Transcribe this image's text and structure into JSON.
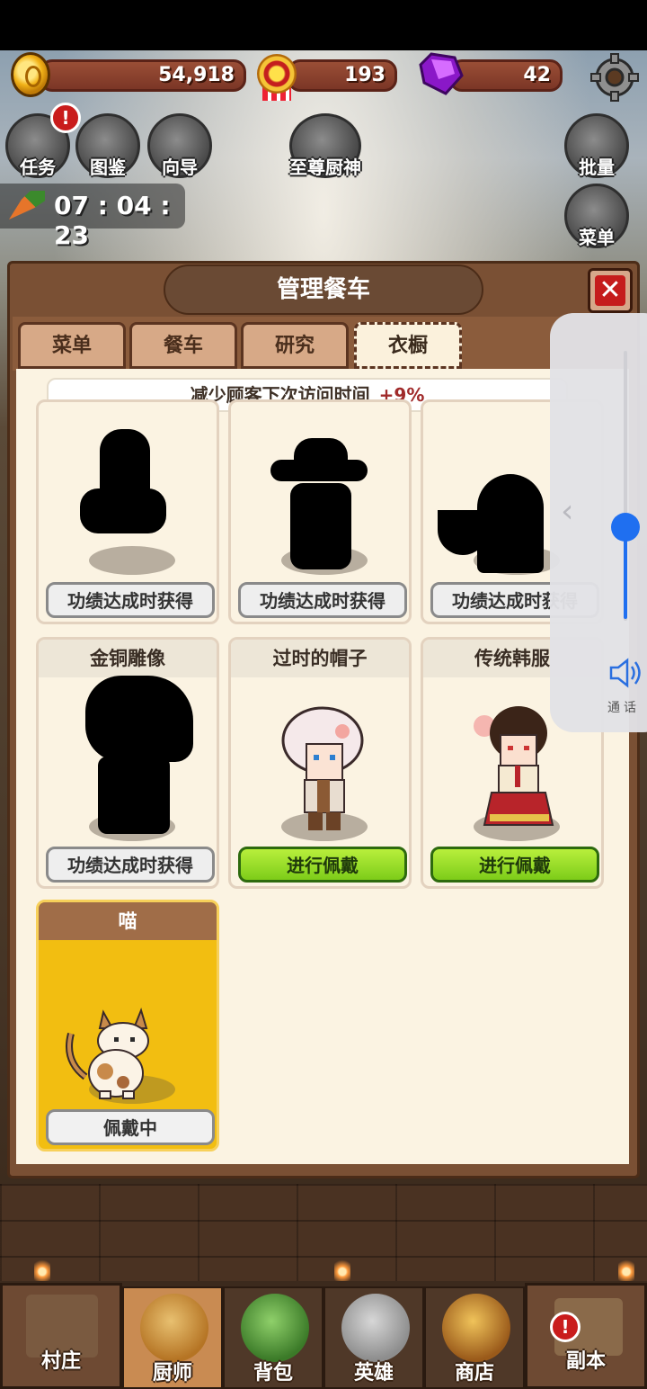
{
  "currency": {
    "gold": "54,918",
    "medals": "193",
    "gems": "42"
  },
  "side_buttons": {
    "quest": "任务",
    "codex": "图鉴",
    "guide": "向导",
    "supreme_chef": "至尊厨神",
    "batch": "批量",
    "menu": "菜单"
  },
  "alert_symbol": "!",
  "timer": "07 : 04 : 23",
  "panel": {
    "title": "管理餐车",
    "close_symbol": "✕",
    "tabs": [
      {
        "label": "菜单"
      },
      {
        "label": "餐车"
      },
      {
        "label": "研究"
      },
      {
        "label": "衣橱",
        "active": true
      }
    ],
    "effect": {
      "text": "减少顾客下次访问时间",
      "value": "+9%"
    }
  },
  "wardrobe": {
    "row1": [
      {
        "button": "功绩达成时获得"
      },
      {
        "button": "功绩达成时获得"
      },
      {
        "button": "功绩达成时获得"
      }
    ],
    "row2": [
      {
        "title": "金铜雕像",
        "button": "功绩达成时获得"
      },
      {
        "title": "过时的帽子",
        "button": "进行佩戴"
      },
      {
        "title": "传统韩服",
        "button": "进行佩戴"
      }
    ],
    "row3": [
      {
        "title": "喵",
        "button": "佩戴中"
      }
    ]
  },
  "volume": {
    "caption": "通话",
    "level": 0.35
  },
  "bottom_nav": {
    "village": "村庄",
    "chef": "厨师",
    "bag": "背包",
    "heroes": "英雄",
    "shop": "商店",
    "dungeon": "副本"
  },
  "colors": {
    "accent_green": "#7dcc19",
    "equipped_yellow": "#f2be11",
    "alert_red": "#c91c1c",
    "volume_blue": "#1f6ff0"
  }
}
